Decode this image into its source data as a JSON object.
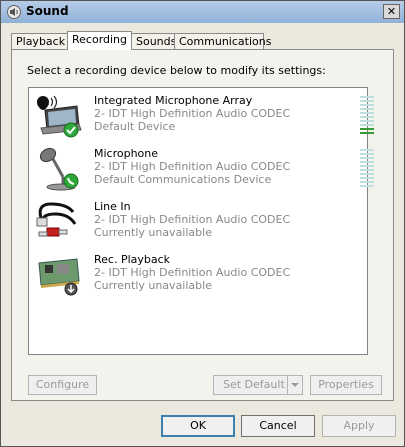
{
  "window": {
    "title": "Sound",
    "close_glyph": "✕"
  },
  "tabs": [
    {
      "label": "Playback",
      "active": false
    },
    {
      "label": "Recording",
      "active": true
    },
    {
      "label": "Sounds",
      "active": false
    },
    {
      "label": "Communications",
      "active": false
    }
  ],
  "panel": {
    "instruction": "Select a recording device below to modify its settings:"
  },
  "devices": [
    {
      "name": "Integrated Microphone Array",
      "driver": "2- IDT High Definition Audio CODEC",
      "status": "Default Device",
      "icon": "microphone-array-icon",
      "badge": "check",
      "meter_level": 0.15
    },
    {
      "name": "Microphone",
      "driver": "2- IDT High Definition Audio CODEC",
      "status": "Default Communications Device",
      "icon": "microphone-icon",
      "badge": "phone",
      "meter_level": 0
    },
    {
      "name": "Line In",
      "driver": "2- IDT High Definition Audio CODEC",
      "status": "Currently unavailable",
      "icon": "rca-cable-icon",
      "badge": "none"
    },
    {
      "name": "Rec. Playback",
      "driver": "2- IDT High Definition Audio CODEC",
      "status": "Currently unavailable",
      "icon": "sound-card-icon",
      "badge": "down-arrow"
    }
  ],
  "buttons": {
    "configure": "Configure",
    "set_default": "Set Default",
    "properties": "Properties",
    "ok": "OK",
    "cancel": "Cancel",
    "apply": "Apply"
  }
}
